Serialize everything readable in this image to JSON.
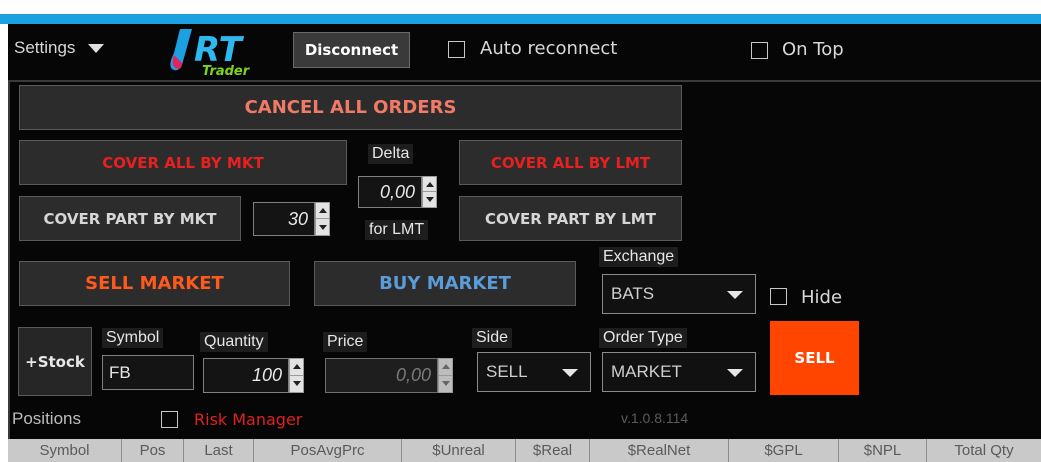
{
  "toolbar": {
    "settings_label": "Settings",
    "logo_text": "RT",
    "logo_subtext": "Trader",
    "disconnect_label": "Disconnect",
    "auto_reconnect_label": "Auto reconnect",
    "on_top_label": "On Top"
  },
  "orders": {
    "cancel_all_label": "CANCEL ALL ORDERS",
    "cover_all_mkt_label": "COVER ALL BY MKT",
    "cover_all_lmt_label": "COVER ALL BY LMT",
    "cover_part_mkt_label": "COVER PART BY MKT",
    "cover_part_lmt_label": "COVER PART BY LMT",
    "cover_part_qty": "30",
    "delta_label": "Delta",
    "delta_value": "0,00",
    "for_lmt_label": "for LMT",
    "sell_market_label": "SELL MARKET",
    "buy_market_label": "BUY MARKET"
  },
  "exchange": {
    "label": "Exchange",
    "value": "BATS",
    "hide_label": "Hide"
  },
  "ticket": {
    "add_stock_label": "+Stock",
    "symbol_label": "Symbol",
    "symbol_value": "FB",
    "quantity_label": "Quantity",
    "quantity_value": "100",
    "price_label": "Price",
    "price_value": "0,00",
    "side_label": "Side",
    "side_value": "SELL",
    "order_type_label": "Order Type",
    "order_type_value": "MARKET",
    "submit_label": "SELL"
  },
  "footer": {
    "positions_label": "Positions",
    "risk_manager_label": "Risk Manager",
    "version": "v.1.0.8.114"
  },
  "positions_table": {
    "columns": [
      "Symbol",
      "Pos",
      "Last",
      "PosAvgPrc",
      "$Unreal",
      "$Real",
      "$RealNet",
      "$GPL",
      "$NPL",
      "Total Qty"
    ]
  },
  "colors": {
    "accent_blue": "#1ba1e2",
    "red_text": "#e02020",
    "orange_text": "#ff5a1e",
    "blue_text": "#5a9bd8",
    "sell_button": "#ff4500"
  }
}
